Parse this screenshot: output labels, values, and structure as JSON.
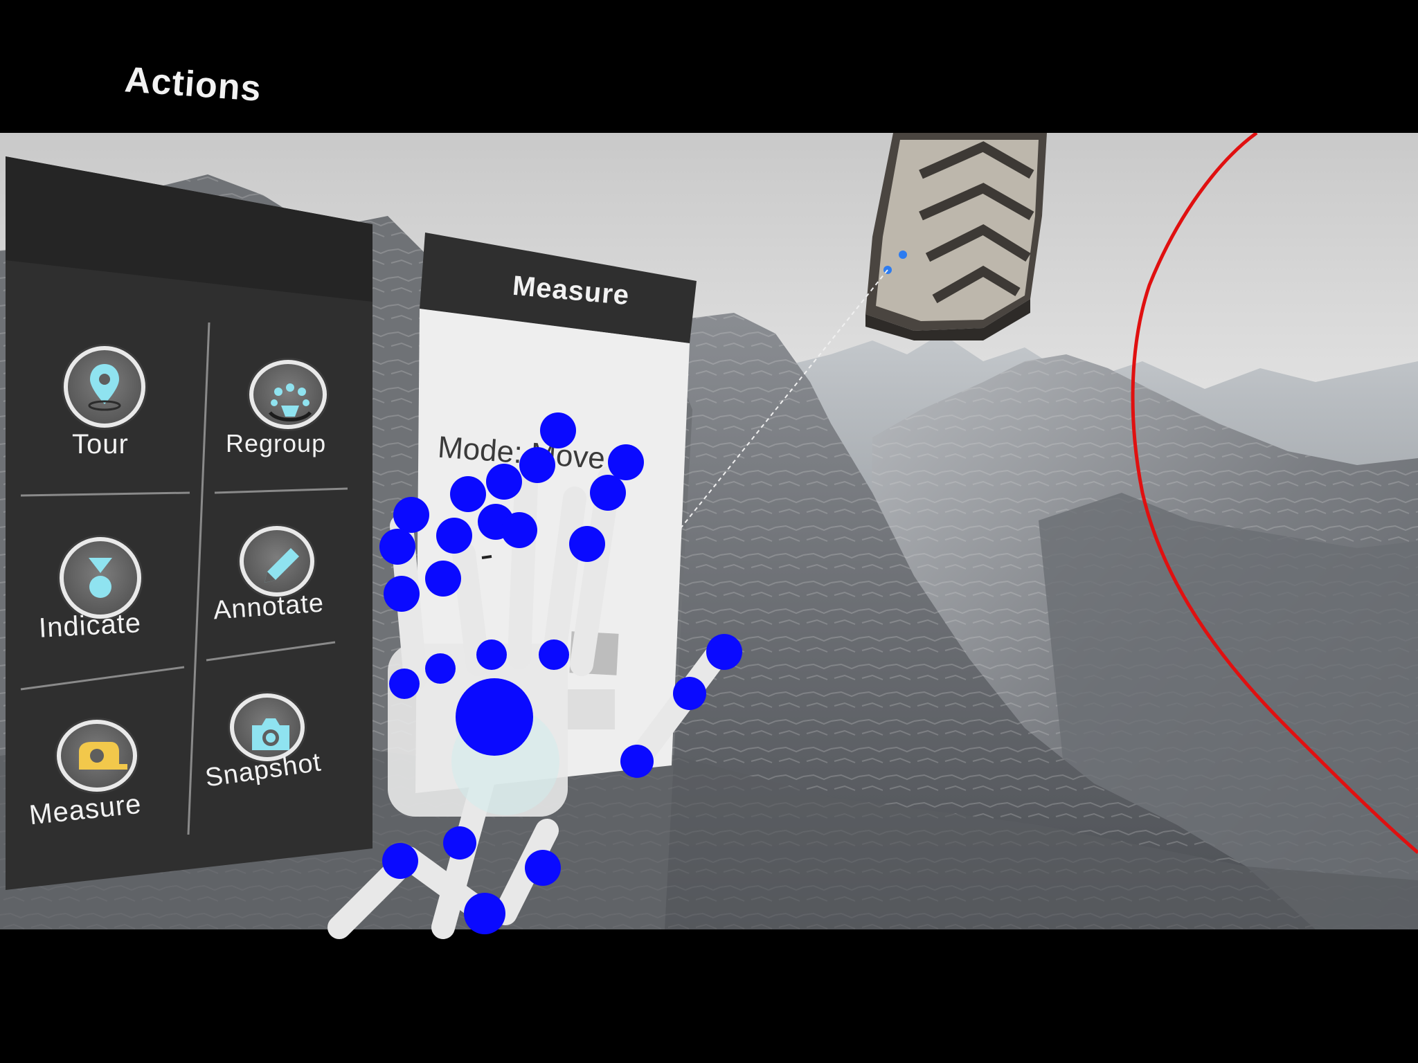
{
  "actions_panel": {
    "title": "Actions",
    "buttons": [
      {
        "id": "tour",
        "label": "Tour",
        "icon": "map-pin-icon"
      },
      {
        "id": "regroup",
        "label": "Regroup",
        "icon": "regroup-icon"
      },
      {
        "id": "indicate",
        "label": "Indicate",
        "icon": "indicate-icon"
      },
      {
        "id": "annotate",
        "label": "Annotate",
        "icon": "pencil-icon"
      },
      {
        "id": "measure",
        "label": "Measure",
        "icon": "tape-measure-icon"
      },
      {
        "id": "snapshot",
        "label": "Snapshot",
        "icon": "camera-icon"
      }
    ]
  },
  "measure_panel": {
    "title": "Measure",
    "mode_text": "Mode: Move"
  },
  "colors": {
    "panel_bg": "#2f2f2f",
    "icon_accent": "#8fe3f0",
    "measure_accent": "#f2c84b",
    "hand_joint": "#0a0aff",
    "boundary_line": "#e01010"
  }
}
